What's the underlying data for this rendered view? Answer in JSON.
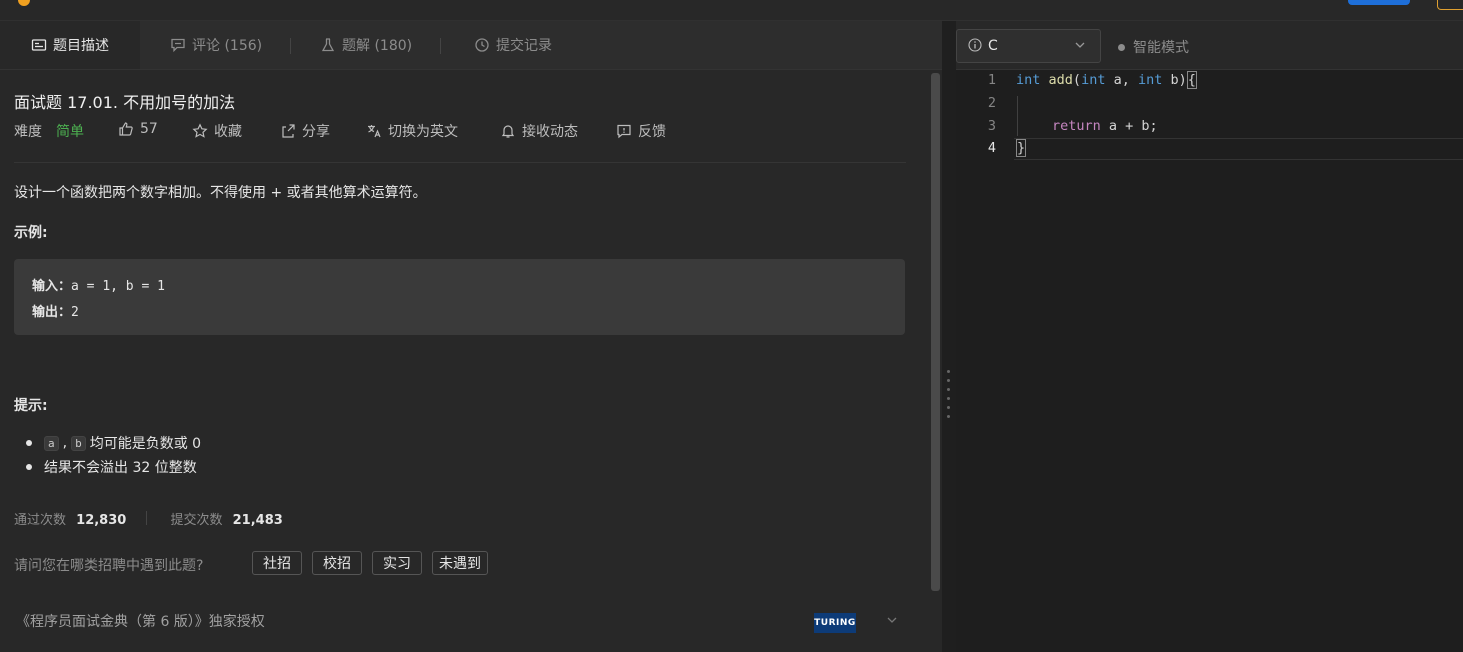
{
  "tabs": [
    {
      "label": "题目描述",
      "icon": "description-icon"
    },
    {
      "label": "评论 (156)",
      "icon": "comment-icon"
    },
    {
      "label": "题解 (180)",
      "icon": "flask-icon"
    },
    {
      "label": "提交记录",
      "icon": "clock-icon"
    }
  ],
  "problem": {
    "title": "面试题 17.01. 不用加号的加法",
    "difficulty_label": "难度",
    "difficulty": "简单",
    "likes": "57",
    "favorite": "收藏",
    "share": "分享",
    "translate": "切换为英文",
    "subscribe": "接收动态",
    "feedback": "反馈",
    "description": "设计一个函数把两个数字相加。不得使用 + 或者其他算术运算符。",
    "example_heading": "示例:",
    "example_input_label": "输入：",
    "example_input": "a = 1, b = 1",
    "example_output_label": "输出：",
    "example_output": "2",
    "hints_heading": "提示:",
    "hint1_a": "a",
    "hint1_sep": ",",
    "hint1_b": "b",
    "hint1_text": "均可能是负数或 0",
    "hint2": "结果不会溢出 32 位整数"
  },
  "stats": {
    "accepted_label": "通过次数",
    "accepted": "12,830",
    "submitted_label": "提交次数",
    "submitted": "21,483"
  },
  "ask": {
    "question": "请问您在哪类招聘中遇到此题?",
    "options": [
      "社招",
      "校招",
      "实习",
      "未遇到"
    ]
  },
  "footer": {
    "source": "《程序员面试金典（第 6 版）》独家授权",
    "publisher_logo": "TURING"
  },
  "editor": {
    "language": "C",
    "mode": "智能模式",
    "line_numbers": [
      "1",
      "2",
      "3",
      "4"
    ],
    "code": {
      "l1_kw1": "int",
      "l1_fn": "add",
      "l1_p1": "(",
      "l1_kw2": "int",
      "l1_a": " a, ",
      "l1_kw3": "int",
      "l1_b": " b)",
      "l1_brace": "{",
      "l3_ret": "return",
      "l3_rest": " a + b;",
      "l4_brace": "}"
    }
  },
  "colors": {
    "easy": "#4caf50",
    "keyword": "#569cd6",
    "function": "#dcdcaa",
    "return": "#c586c0"
  }
}
